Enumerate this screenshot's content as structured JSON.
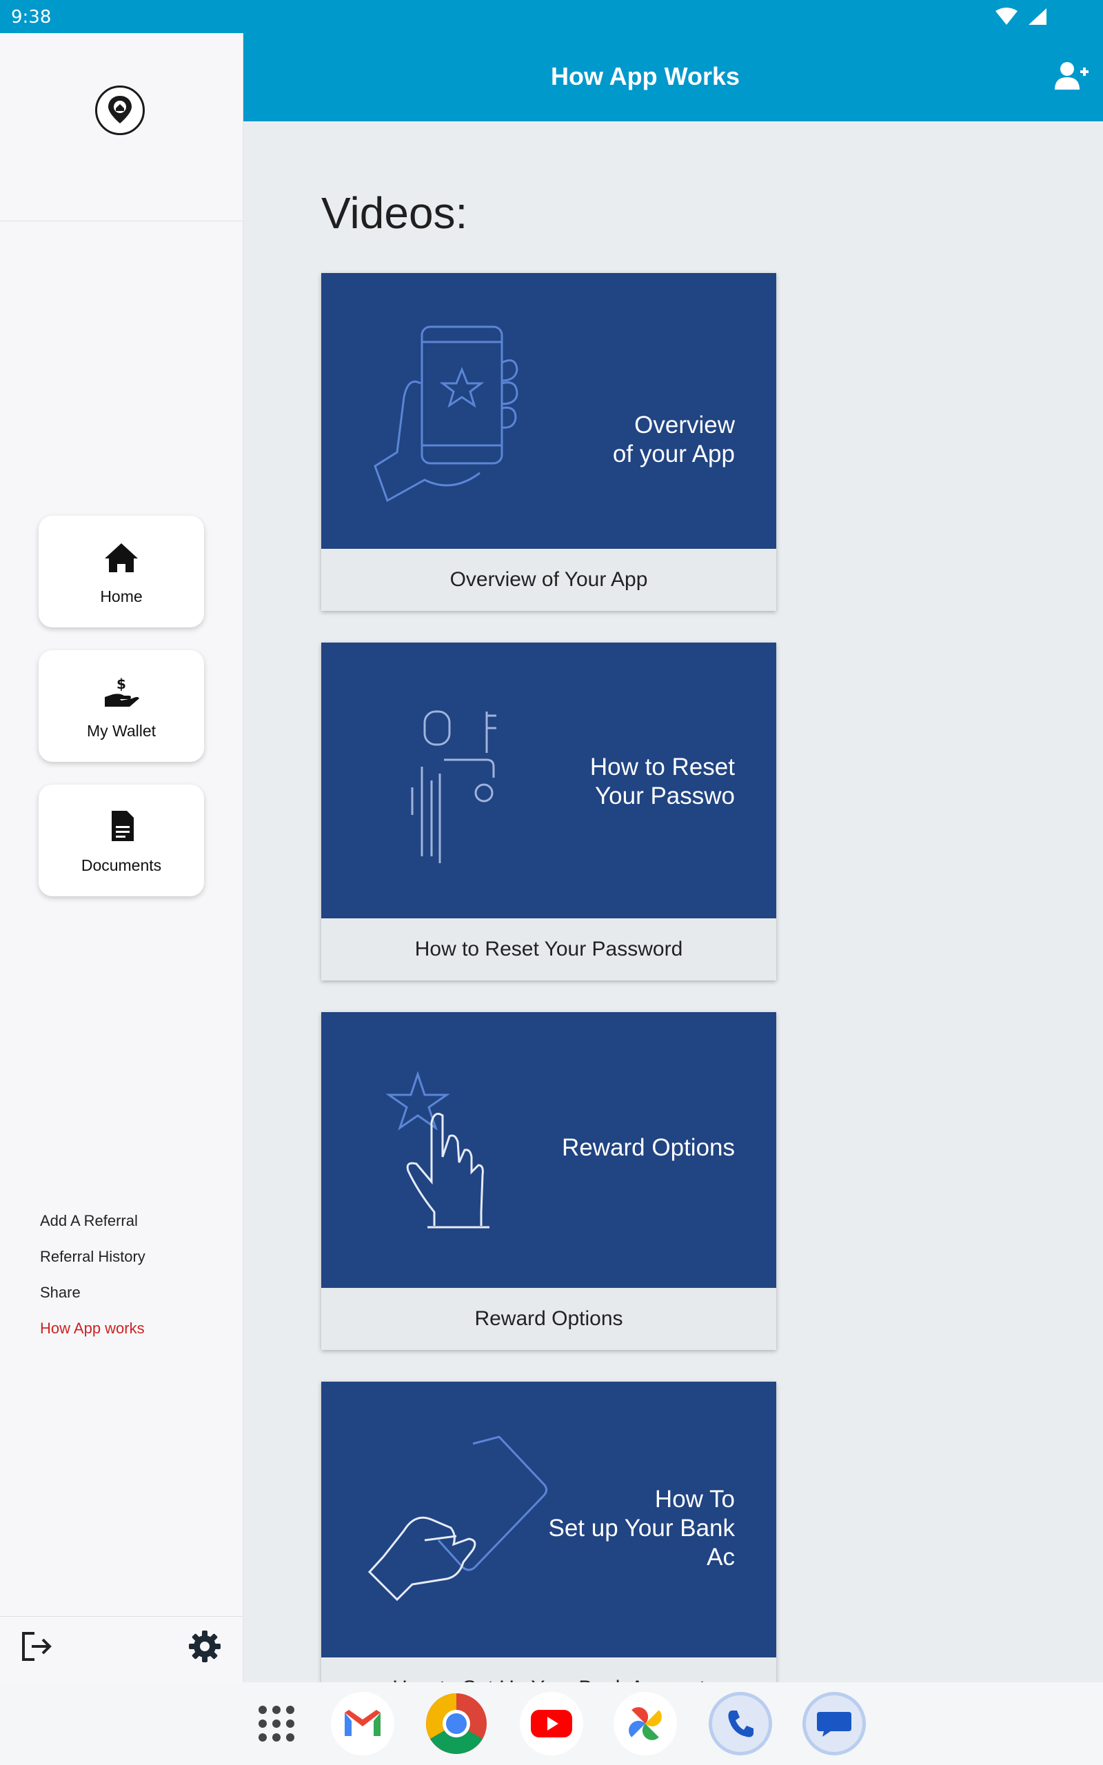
{
  "status_bar": {
    "time": "9:38"
  },
  "app_bar": {
    "title": "How App Works"
  },
  "drawer": {
    "nav_cards": [
      {
        "label": "Home",
        "icon": "home-icon"
      },
      {
        "label": "My Wallet",
        "icon": "wallet-icon"
      },
      {
        "label": "Documents",
        "icon": "document-icon"
      }
    ],
    "links": [
      {
        "label": "Add A Referral",
        "active": false
      },
      {
        "label": "Referral History",
        "active": false
      },
      {
        "label": "Share",
        "active": false
      },
      {
        "label": "How App works",
        "active": true
      }
    ],
    "footer_icons": [
      "logout-icon",
      "gear-icon"
    ]
  },
  "content": {
    "heading": "Videos:",
    "videos": [
      {
        "caption": "Overview of Your App",
        "thumb_lines": [
          "Overview",
          "of your App"
        ]
      },
      {
        "caption": "How to Reset Your Password",
        "thumb_lines": [
          "How to Reset",
          "Your Passwo"
        ]
      },
      {
        "caption": "Reward Options",
        "thumb_lines": [
          "Reward Options"
        ]
      },
      {
        "caption": "How to Set Up Your Bank Account",
        "thumb_lines": [
          "How To",
          "Set up Your Bank",
          "Ac"
        ]
      }
    ]
  },
  "dock": {
    "apps": [
      "app-grid-icon",
      "gmail-icon",
      "chrome-icon",
      "youtube-icon",
      "photos-icon",
      "phone-icon",
      "messages-icon"
    ]
  },
  "colors": {
    "primary": "#0099cc",
    "thumbnail_bg": "#214482",
    "active_link": "#cc2222"
  }
}
